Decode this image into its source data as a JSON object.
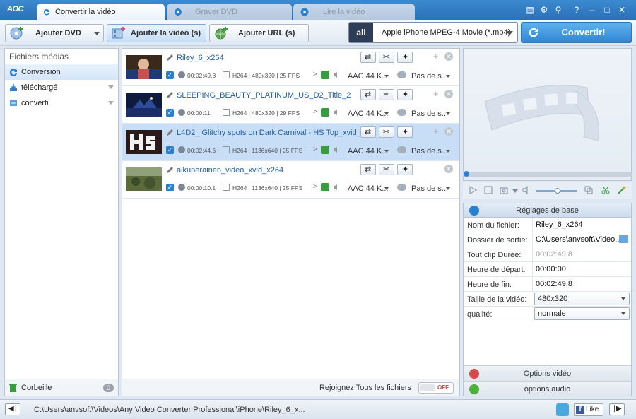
{
  "app": {
    "logo": "AOC",
    "tabs": [
      {
        "label": "Convertir la vidéo",
        "active": true
      },
      {
        "label": "Graver DVD",
        "active": false
      },
      {
        "label": "Lire la vidéo",
        "active": false
      }
    ]
  },
  "toolbar": {
    "add_dvd": "Ajouter DVD",
    "add_video": "Ajouter la vidéo (s)",
    "add_url": "Ajouter URL (s)",
    "profile": "Apple iPhone MPEG-4 Movie (*.mp4)",
    "profile_icon": "all",
    "convert": "Convertir!"
  },
  "sidebar": {
    "header": "Fichiers médias",
    "items": [
      {
        "label": "Conversion",
        "icon": "conversion-icon"
      },
      {
        "label": "téléchargé",
        "icon": "download-icon"
      },
      {
        "label": "converti",
        "icon": "converted-icon"
      }
    ],
    "trash_label": "Corbeille",
    "trash_count": "0"
  },
  "files": [
    {
      "name": "Riley_6_x264",
      "duration": "00:02:49.8",
      "codec": "H264 | 480x320 | 25 FPS",
      "audio": "AAC 44 K...",
      "subtitle": "Pas de s..."
    },
    {
      "name": "SLEEPING_BEAUTY_PLATINUM_US_D2_Title_2",
      "duration": "00:00:11",
      "codec": "H264 | 480x320 | 29 FPS",
      "audio": "AAC 44 K...",
      "subtitle": "Pas de s..."
    },
    {
      "name": "L4D2_ Glitchy spots on Dark Carnival - HS Top_xvid_...",
      "duration": "00:02:44.6",
      "codec": "H264 | 1136x640 | 25 FPS",
      "audio": "AAC 44 K...",
      "subtitle": "Pas de s..."
    },
    {
      "name": "alkuperainen_video_xvid_x264",
      "duration": "00:00:10.1",
      "codec": "H264 | 1136x640 | 25 FPS",
      "audio": "AAC 44 K...",
      "subtitle": "Pas de s..."
    }
  ],
  "join": {
    "label": "Rejoignez Tous les fichiers",
    "toggle": "OFF"
  },
  "settings": {
    "header": "Réglages de base",
    "rows": [
      {
        "label": "Nom du fichier:",
        "value": "Riley_6_x264"
      },
      {
        "label": "Dossier de sortie:",
        "value": "C:\\Users\\anvsoft\\Video..."
      },
      {
        "label": "Tout clip Durée:",
        "value": "00:02:49.8"
      },
      {
        "label": "Heure de départ:",
        "value": "00:00:00"
      },
      {
        "label": "Heure de fin:",
        "value": "00:02:49.8"
      },
      {
        "label": "Taille de la vidéo:",
        "value": "480x320"
      },
      {
        "label": "qualité:",
        "value": "normale"
      }
    ],
    "video_options": "Options vidéo",
    "audio_options": "options audio"
  },
  "status": {
    "path": "C:\\Users\\anvsoft\\Videos\\Any Video Converter Professional\\iPhone\\Riley_6_x...",
    "facebook": "Like"
  },
  "colors": {
    "accent": "#2a7fd1",
    "selected_row": "#c8def6",
    "titlebar": "#2a6fb8"
  }
}
